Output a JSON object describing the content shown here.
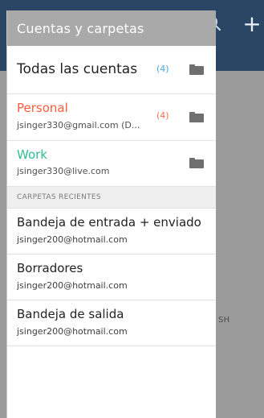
{
  "background": {
    "search_icon": "search-icon",
    "plus_icon": "plus-icon",
    "truncated_text": "SH"
  },
  "drawer": {
    "title": "Cuentas y carpetas",
    "accounts": [
      {
        "name": "Todas las cuentas",
        "email": "",
        "count": "(4)",
        "name_color": "#222222",
        "count_color": "#46a9df"
      },
      {
        "name": "Personal",
        "email": "jsinger330@gmail.com (D...",
        "count": "(4)",
        "name_color": "#ff5a3c",
        "count_color": "#ff6b52"
      },
      {
        "name": "Work",
        "email": "jsinger330@live.com",
        "count": "",
        "name_color": "#2fbf8f",
        "count_color": ""
      }
    ],
    "recent_header": "CARPETAS RECIENTES",
    "recent_folders": [
      {
        "name": "Bandeja de entrada + enviado",
        "email": "jsinger200@hotmail.com"
      },
      {
        "name": "Borradores",
        "email": "jsinger200@hotmail.com"
      },
      {
        "name": "Bandeja de salida",
        "email": "jsinger200@hotmail.com"
      }
    ]
  },
  "colors": {
    "drawer_header_bg": "#a9a9a9",
    "topbar_bg": "#2b4664",
    "scrim": "#9b9b9b"
  }
}
